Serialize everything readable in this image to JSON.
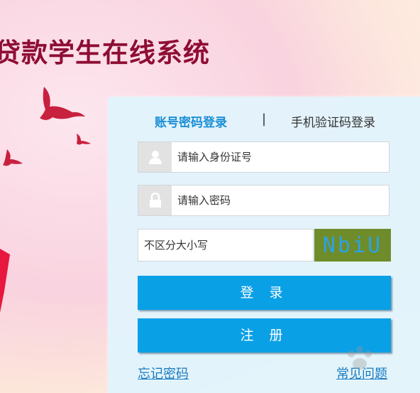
{
  "header": {
    "title": "贷款学生在线系统"
  },
  "login": {
    "tabs": {
      "account": "账号密码登录",
      "separator": "|",
      "sms": "手机验证码登录"
    },
    "id_field": {
      "placeholder": "请输入身份证号",
      "icon": "user-icon"
    },
    "password_field": {
      "placeholder": "请输入密码",
      "icon": "lock-icon"
    },
    "captcha_field": {
      "placeholder": "不区分大小写"
    },
    "captcha_code": "NbiU",
    "login_button": "登 录",
    "register_button": "注 册",
    "forgot_link": "忘记密码",
    "faq_link": "常见问题"
  },
  "colors": {
    "title": "#8e0d34",
    "accent": "#0aa0e6",
    "captcha_bg": "#6f8c2b",
    "link": "#1a7bbf"
  }
}
